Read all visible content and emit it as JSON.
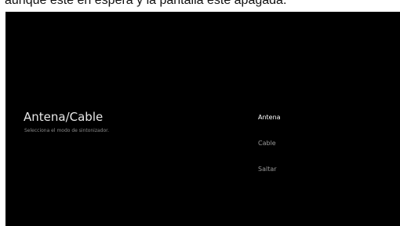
{
  "caption": {
    "text": "aunque esté en espera y la pantalla esté apagada."
  },
  "setup": {
    "title": "Antena/Cable",
    "subtitle": "Selecciona el modo de sintonizador.",
    "options": [
      {
        "label": "Antena",
        "selected": true
      },
      {
        "label": "Cable",
        "selected": false
      },
      {
        "label": "Saltar",
        "selected": false
      }
    ]
  },
  "colors": {
    "screen_background": "#000000",
    "text_primary": "#e8e8e8",
    "text_secondary": "#8a8a8a"
  }
}
